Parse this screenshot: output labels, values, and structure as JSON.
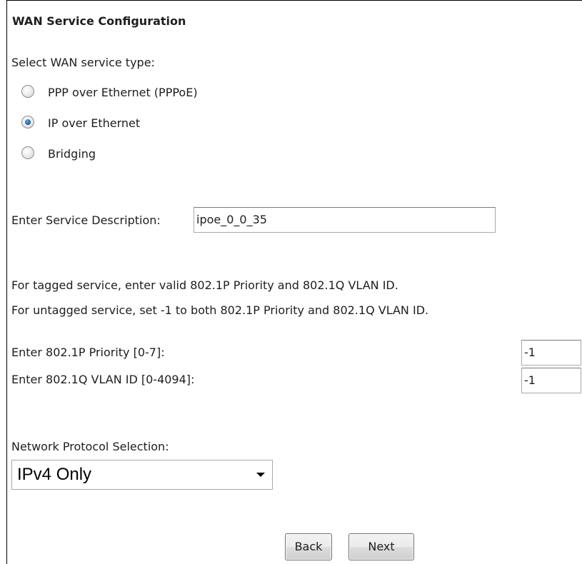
{
  "page_title": "WAN Service Configuration",
  "service_type": {
    "label": "Select WAN service type:",
    "options": [
      {
        "label": "PPP over Ethernet (PPPoE)",
        "checked": false
      },
      {
        "label": "IP over Ethernet",
        "checked": true
      },
      {
        "label": "Bridging",
        "checked": false
      }
    ]
  },
  "service_description": {
    "label": "Enter Service Description:",
    "value": "ipoe_0_0_35"
  },
  "vlan_info": {
    "tagged_note": "For tagged service, enter valid 802.1P Priority and 802.1Q VLAN ID.",
    "untagged_note": "For untagged service, set -1 to both 802.1P Priority and 802.1Q VLAN ID."
  },
  "priority": {
    "label": "Enter 802.1P Priority [0-7]:",
    "value": "-1"
  },
  "vlan_id": {
    "label": "Enter 802.1Q VLAN ID [0-4094]:",
    "value": "-1"
  },
  "protocol": {
    "label": "Network Protocol Selection:",
    "selected": "IPv4 Only"
  },
  "buttons": {
    "back": "Back",
    "next": "Next"
  },
  "icons": {
    "radio_checked_color": "#1c5fb8",
    "dropdown": "chevron-down-icon"
  }
}
